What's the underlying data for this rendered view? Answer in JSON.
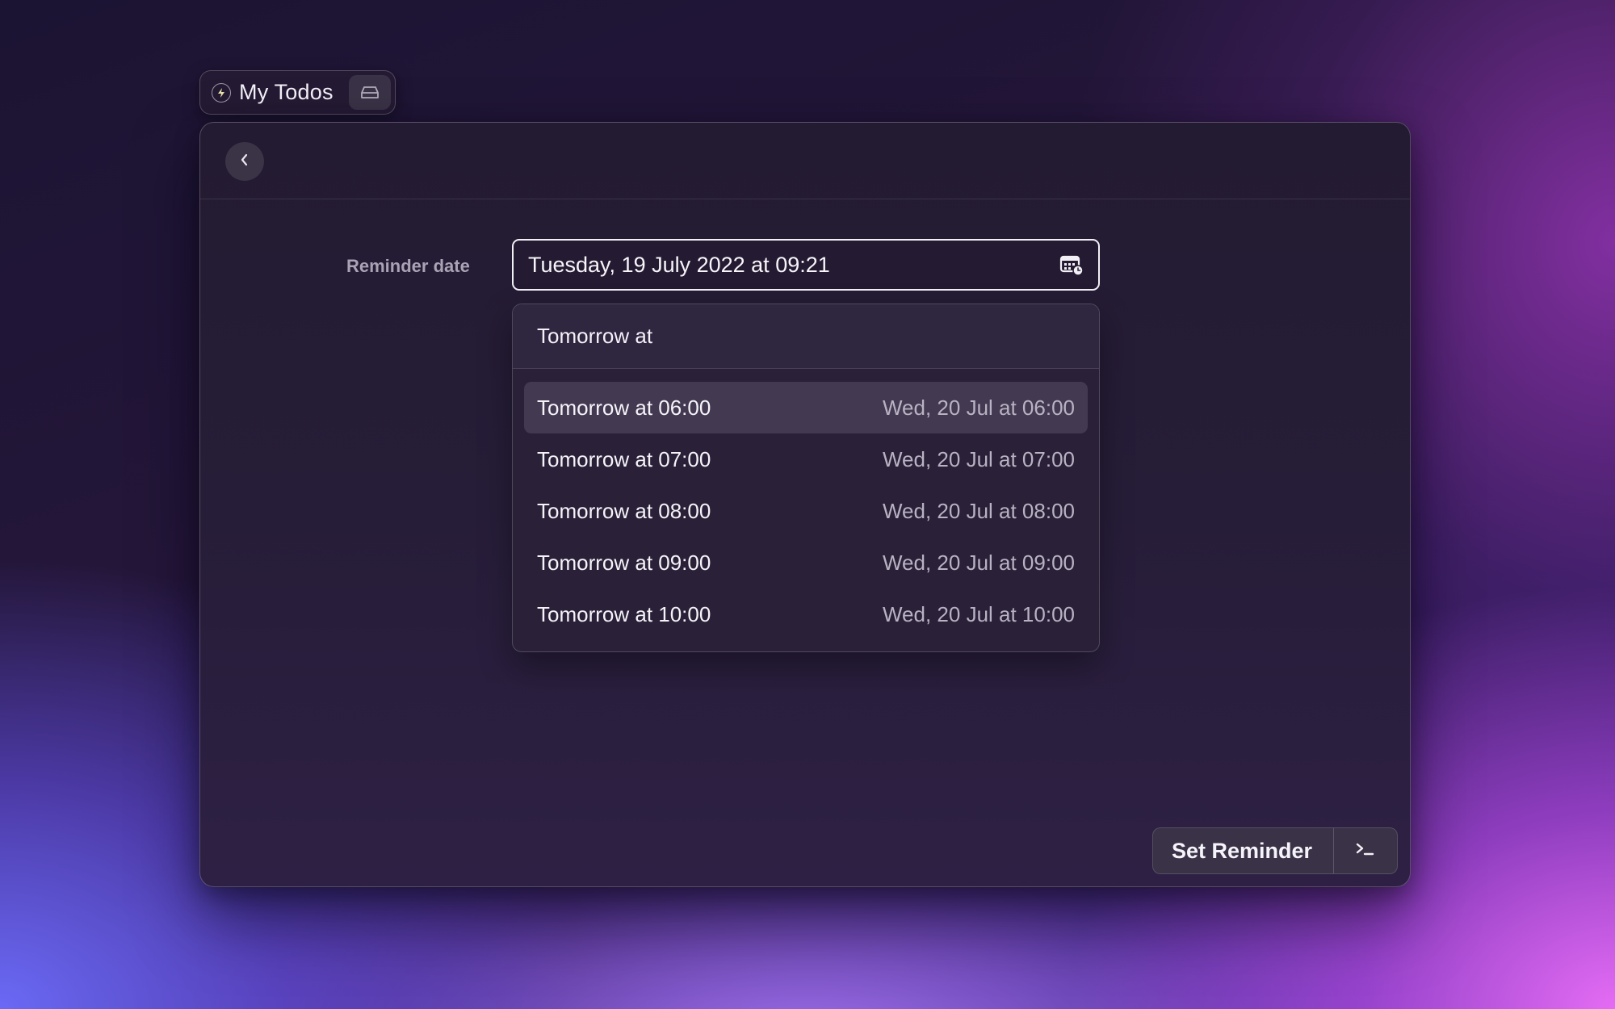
{
  "tab": {
    "title": "My Todos",
    "logo_icon": "raycast-bolt-icon",
    "tray_icon": "inbox-tray-icon"
  },
  "header": {
    "back_icon": "chevron-left-icon"
  },
  "form": {
    "reminder_label": "Reminder date",
    "reminder_value": "Tuesday, 19 July 2022 at 09:21",
    "calendar_icon": "calendar-clock-icon"
  },
  "dropdown": {
    "query": "Tomorrow at",
    "items": [
      {
        "label": "Tomorrow at 06:00",
        "detail": "Wed, 20 Jul at 06:00",
        "selected": true
      },
      {
        "label": "Tomorrow at 07:00",
        "detail": "Wed, 20 Jul at 07:00",
        "selected": false
      },
      {
        "label": "Tomorrow at 08:00",
        "detail": "Wed, 20 Jul at 08:00",
        "selected": false
      },
      {
        "label": "Tomorrow at 09:00",
        "detail": "Wed, 20 Jul at 09:00",
        "selected": false
      },
      {
        "label": "Tomorrow at 10:00",
        "detail": "Wed, 20 Jul at 10:00",
        "selected": false
      }
    ]
  },
  "actions": {
    "primary_label": "Set Reminder",
    "secondary_icon": "terminal-prompt-icon"
  }
}
